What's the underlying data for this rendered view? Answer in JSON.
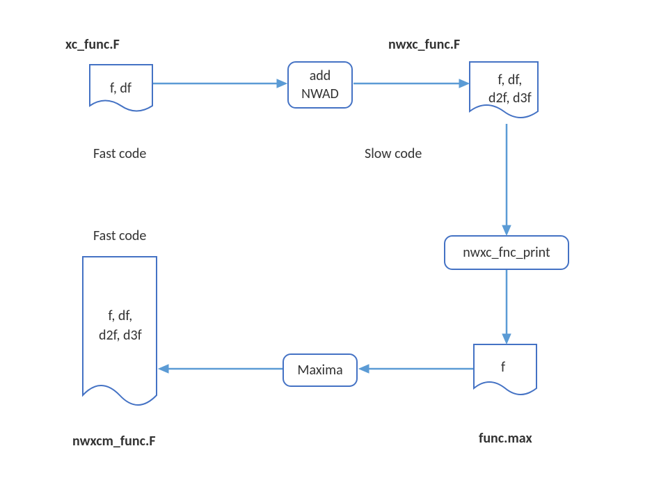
{
  "labels": {
    "xc_func": "xc_func.F",
    "nwxc_func": "nwxc_func.F",
    "fast_code1": "Fast code",
    "slow_code": "Slow code",
    "fast_code2": "Fast code",
    "nwxcm_func": "nwxcm_func.F",
    "func_max": "func.max"
  },
  "docs": {
    "doc1": "f, df",
    "doc2_line1": "f, df,",
    "doc2_line2": "d2f, d3f",
    "doc3_line1": "f, df,",
    "doc3_line2": "d2f, d3f",
    "doc4": "f"
  },
  "procs": {
    "add_nwad_line1": "add",
    "add_nwad_line2": "NWAD",
    "nwxc_fnc_print": "nwxc_fnc_print",
    "maxima": "Maxima"
  }
}
